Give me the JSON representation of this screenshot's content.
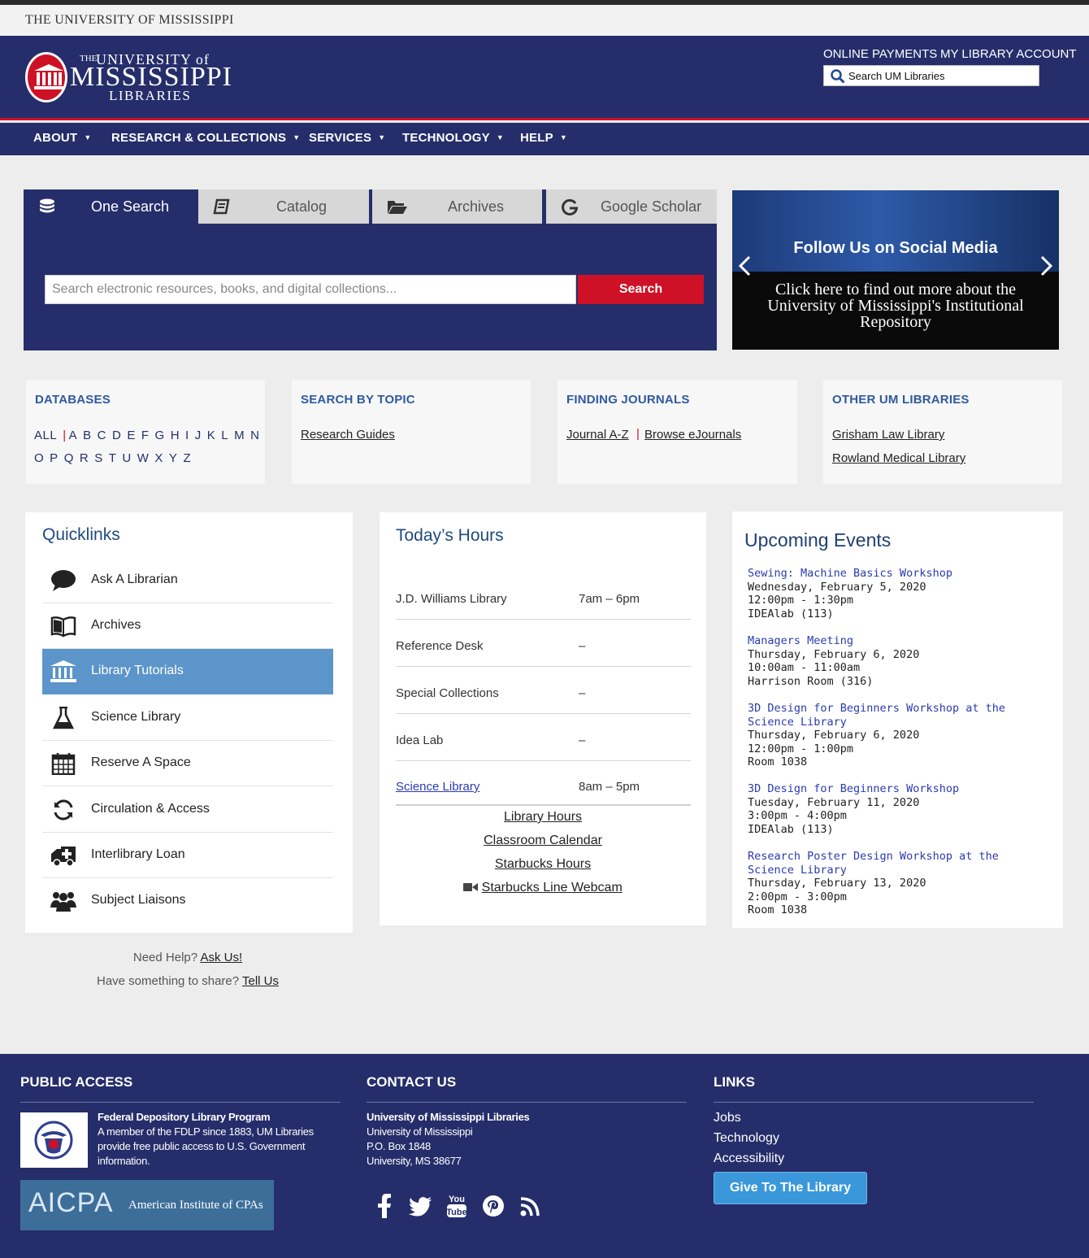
{
  "top_strip": {
    "text": "THE UNIVERSITY OF MISSISSIPPI"
  },
  "header": {
    "logo_the": "THE",
    "logo_university": "UNIVERSITY of",
    "logo_mississippi": "MISSISSIPPI",
    "logo_libraries": "LIBRARIES",
    "links": [
      "ONLINE PAYMENTS",
      "MY LIBRARY ACCOUNT"
    ],
    "search_placeholder": "Search UM Libraries"
  },
  "nav": {
    "items": [
      "ABOUT",
      "RESEARCH & COLLECTIONS",
      "SERVICES",
      "TECHNOLOGY",
      "HELP"
    ],
    "caret": "▼"
  },
  "search_box": {
    "tabs": [
      {
        "label": "One Search",
        "icon": "database-icon"
      },
      {
        "label": "Catalog",
        "icon": "book-icon"
      },
      {
        "label": "Archives",
        "icon": "folder-open-icon"
      },
      {
        "label": "Google Scholar",
        "icon": "google-icon"
      }
    ],
    "placeholder": "Search electronic resources, books, and digital collections...",
    "button": "Search"
  },
  "carousel": {
    "title": "Follow Us on Social Media",
    "caption": "Click here to find out more about the University of Mississippi's Institutional Repository"
  },
  "quick_boxes": {
    "databases": {
      "heading": "DATABASES",
      "all": "ALL",
      "separator": "|",
      "row1": [
        "A",
        "B",
        "C",
        "D",
        "E",
        "F",
        "G",
        "H",
        "I",
        "J",
        "K",
        "L",
        "M",
        "N"
      ],
      "row2": [
        "O",
        "P",
        "Q",
        "R",
        "S",
        "T",
        "U",
        "W",
        "X",
        "Y",
        "Z"
      ]
    },
    "search_by_topic": {
      "heading": "SEARCH BY TOPIC",
      "link": "Research Guides"
    },
    "finding_journals": {
      "heading": "FINDING JOURNALS",
      "link1": "Journal A-Z",
      "separator": "|",
      "link2": "Browse eJournals"
    },
    "other_libraries": {
      "heading": "OTHER UM LIBRARIES",
      "link1": "Grisham Law Library",
      "link2": "Rowland Medical Library"
    }
  },
  "quicklinks": {
    "title": "Quicklinks",
    "items": [
      {
        "label": "Ask A Librarian",
        "icon": "speech-bubble-icon"
      },
      {
        "label": "Archives",
        "icon": "open-book-icon"
      },
      {
        "label": "Library Tutorials",
        "icon": "institution-icon"
      },
      {
        "label": "Science Library",
        "icon": "flask-icon"
      },
      {
        "label": "Reserve A Space",
        "icon": "calendar-icon"
      },
      {
        "label": "Circulation & Access",
        "icon": "refresh-icon"
      },
      {
        "label": "Interlibrary Loan",
        "icon": "ambulance-icon"
      },
      {
        "label": "Subject Liaisons",
        "icon": "users-icon"
      }
    ],
    "active_index": 2
  },
  "hours": {
    "title": "Today’s Hours",
    "rows": [
      {
        "name": "J.D. Williams Library",
        "time": "7am – 6pm"
      },
      {
        "name": "Reference Desk",
        "time": "–"
      },
      {
        "name": "Special Collections",
        "time": "–"
      },
      {
        "name": "Idea Lab",
        "time": "–"
      },
      {
        "name": "Science Library",
        "time": "8am – 5pm"
      }
    ],
    "links": [
      "Library Hours",
      "Classroom Calendar",
      "Starbucks Hours",
      "Starbucks Line Webcam"
    ]
  },
  "events": {
    "title": "Upcoming Events",
    "items": [
      {
        "title": "Sewing: Machine Basics Workshop",
        "date": "Wednesday, February 5, 2020",
        "time": "12:00pm - 1:30pm",
        "room": "IDEAlab (113)"
      },
      {
        "title": "Managers Meeting",
        "date": "Thursday, February 6, 2020",
        "time": "10:00am - 11:00am",
        "room": "Harrison Room (316)"
      },
      {
        "title": "3D Design for Beginners Workshop at the Science Library",
        "date": "Thursday, February 6, 2020",
        "time": "12:00pm - 1:00pm",
        "room": "Room 1038"
      },
      {
        "title": "3D Design for Beginners Workshop",
        "date": "Tuesday, February 11, 2020",
        "time": "3:00pm - 4:00pm",
        "room": "IDEAlab (113)"
      },
      {
        "title": "Research Poster Design Workshop at the Science Library",
        "date": "Thursday, February 13, 2020",
        "time": "2:00pm - 3:00pm",
        "room": "Room 1038"
      }
    ]
  },
  "help": {
    "need_help": "Need Help?",
    "ask_us": "Ask Us!",
    "share": "Have something to share?",
    "tell_us": "Tell Us"
  },
  "footer": {
    "public_access": {
      "heading": "PUBLIC ACCESS",
      "fdlp_title": "Federal Depository Library Program",
      "fdlp_text": "A member of the FDLP since 1883, UM Libraries provide free public access to U.S. Government information.",
      "aicpa": "AICPA",
      "aicpa_sub": "American Institute of CPAs"
    },
    "contact": {
      "heading": "CONTACT US",
      "org": "University of Mississippi Libraries",
      "lines": [
        "University of Mississippi",
        "P.O. Box 1848",
        "University, MS 38677"
      ],
      "social": [
        "facebook-icon",
        "twitter-icon",
        "youtube-icon",
        "pinterest-icon",
        "rss-icon"
      ]
    },
    "links": {
      "heading": "LINKS",
      "items": [
        "Jobs",
        "Technology",
        "Accessibility"
      ],
      "give": "Give To The Library"
    }
  },
  "colors": {
    "navy": "#252e6a",
    "red": "#ce1126",
    "link_blue": "#2f5aa0",
    "active_blue": "#5b95c9",
    "give_blue": "#3a98da"
  }
}
